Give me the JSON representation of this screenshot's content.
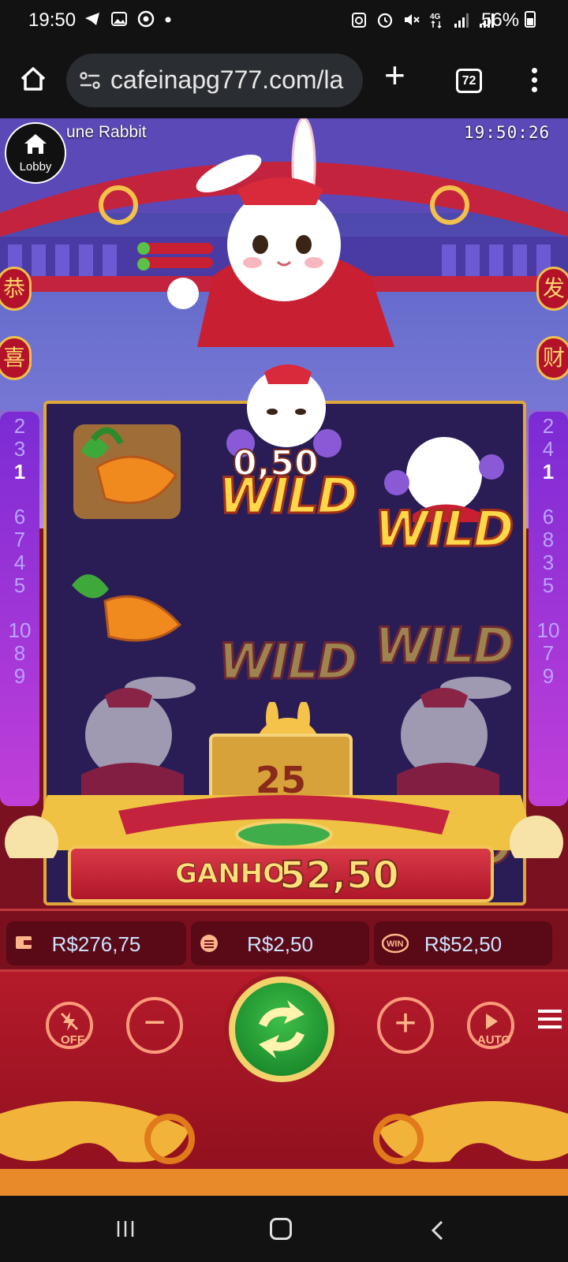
{
  "status_bar": {
    "time": "19:50",
    "battery": "56%",
    "left_icons": [
      "telegram-icon",
      "gallery-icon",
      "chrome-icon",
      "dot-icon"
    ],
    "right_icons": [
      "sync-icon",
      "alarm-icon",
      "mute-icon",
      "4g-icon",
      "signal-icon",
      "signal-icon",
      "battery-icon"
    ]
  },
  "browser": {
    "url": "cafeinapg777.com/la",
    "tab_count": "72"
  },
  "game": {
    "title": "une Rabbit",
    "clock": "19:50:26",
    "lobby_label": "Lobby",
    "pillar_left_chars": [
      "恭",
      "喜"
    ],
    "pillar_right_chars": [
      "发",
      "财"
    ],
    "lines_left": [
      "2",
      "3",
      "1",
      "6",
      "7",
      "4",
      "5",
      "10",
      "8",
      "9"
    ],
    "lines_right": [
      "2",
      "4",
      "1",
      "6",
      "8",
      "3",
      "5",
      "10",
      "7",
      "9"
    ],
    "active_line": "1",
    "reels": [
      [
        "carrot-icon",
        "carrot-icon",
        "wild-icon"
      ],
      [
        "wild-icon",
        "gold-ingot-icon",
        "counter-icon"
      ],
      [
        "wild-icon",
        "wild-icon",
        "wild-icon"
      ]
    ],
    "wild_text": "WILD",
    "multiplier_label": "0,50",
    "counter_value": "25",
    "win_label": "GANHO",
    "win_value": "52,50",
    "balance": "R$276,75",
    "bet": "R$2,50",
    "win_amount": "R$52,50",
    "turbo_label": "OFF",
    "auto_label": "AUTO",
    "colors": {
      "frame_gold": "#e0a83a",
      "wild_yellow": "#ffd84a",
      "panel_red": "#b51a2a",
      "spin_green": "#1f9a30"
    }
  }
}
